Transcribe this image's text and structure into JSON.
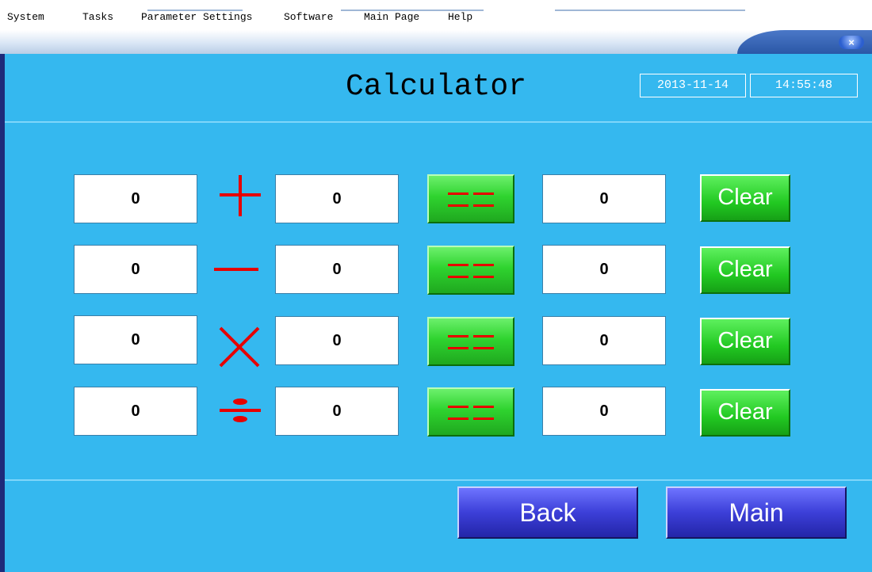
{
  "menu": {
    "items": [
      "System",
      "Tasks",
      "Parameter Settings",
      "Software",
      "Main Page",
      "Help"
    ]
  },
  "window": {
    "close_icon": "×"
  },
  "header": {
    "title": "Calculator",
    "date": "2013-11-14",
    "time": "14:55:48"
  },
  "calculator": {
    "rows": [
      {
        "operator": "plus-icon",
        "a": "0",
        "b": "0",
        "result": "0",
        "clear_label": "Clear"
      },
      {
        "operator": "minus-icon",
        "a": "0",
        "b": "0",
        "result": "0",
        "clear_label": "Clear"
      },
      {
        "operator": "multiply-icon",
        "a": "0",
        "b": "0",
        "result": "0",
        "clear_label": "Clear"
      },
      {
        "operator": "divide-icon",
        "a": "0",
        "b": "0",
        "result": "0",
        "clear_label": "Clear"
      }
    ],
    "equals_icon": "equals-icon"
  },
  "footer": {
    "back_label": "Back",
    "main_label": "Main"
  },
  "colors": {
    "panel_background": "#35b8ef",
    "operator_red": "#e60000",
    "clear_green": "#22c922",
    "nav_blue": "#3c3fd8"
  }
}
